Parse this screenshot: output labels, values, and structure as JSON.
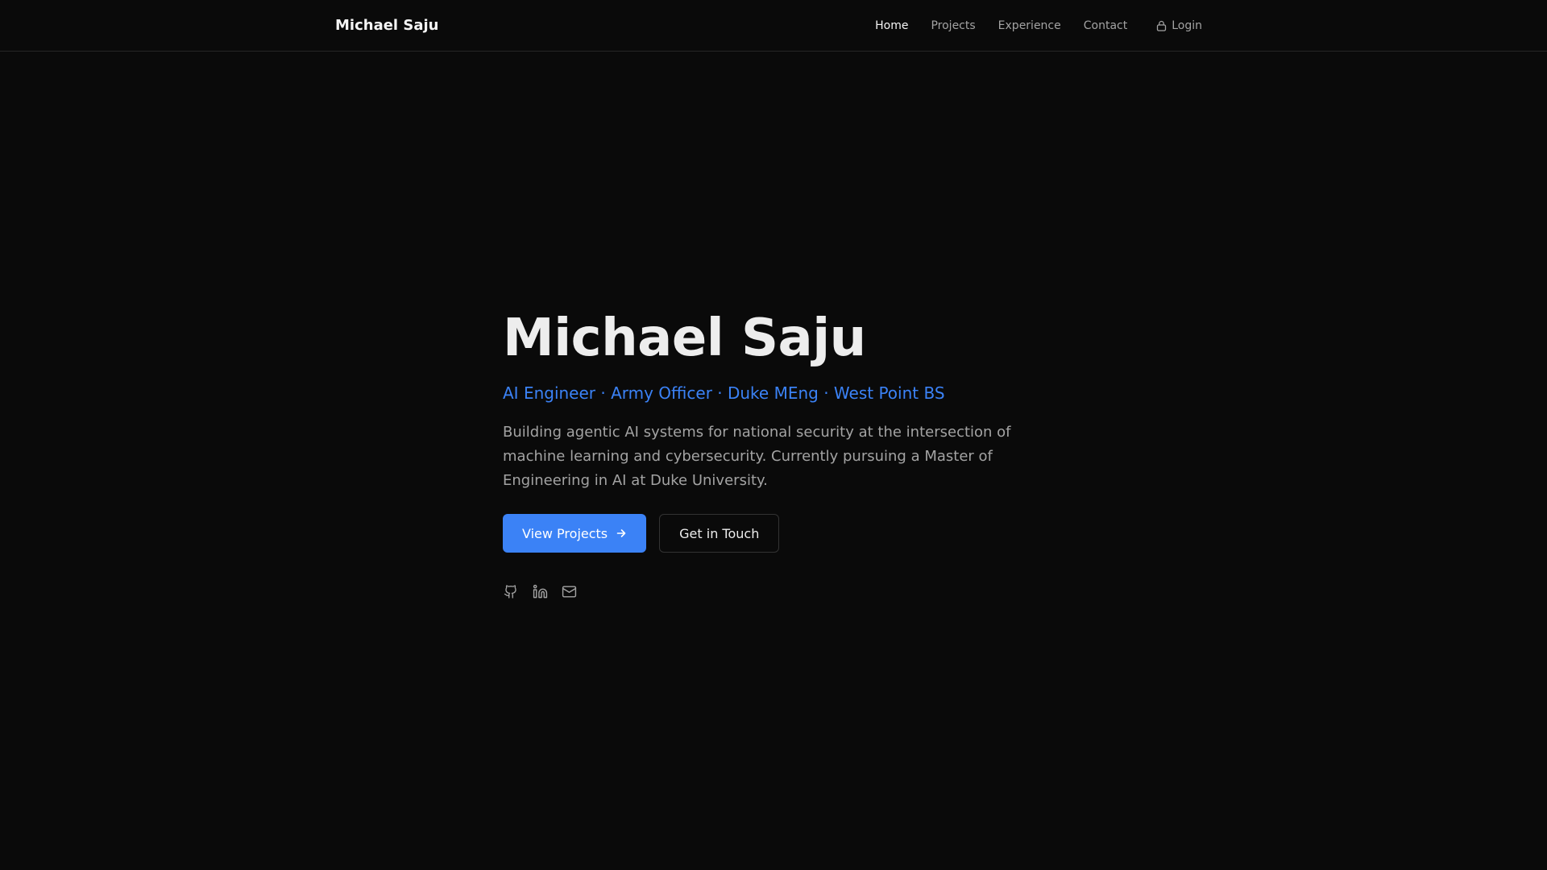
{
  "nav": {
    "brand": "Michael Saju",
    "links": [
      {
        "label": "Home",
        "active": true
      },
      {
        "label": "Projects",
        "active": false
      },
      {
        "label": "Experience",
        "active": false
      },
      {
        "label": "Contact",
        "active": false
      }
    ],
    "login_label": "Login",
    "login_icon": "lock-icon"
  },
  "hero": {
    "title": "Michael Saju",
    "subtitle": "AI Engineer · Army Officer · Duke MEng · West Point BS",
    "description": "Building agentic AI systems for national security at the intersection of machine learning and cybersecurity. Currently pursuing a Master of Engineering in AI at Duke University.",
    "primary_button": "View Projects",
    "primary_button_icon": "arrow-right-icon",
    "secondary_button": "Get in Touch"
  },
  "socials": [
    {
      "icon": "github-icon"
    },
    {
      "icon": "linkedin-icon"
    },
    {
      "icon": "mail-icon"
    }
  ],
  "colors": {
    "background": "#0a0a0a",
    "accent": "#3b82f6",
    "muted_text": "#a3a3a3",
    "primary_text": "#ededed"
  }
}
